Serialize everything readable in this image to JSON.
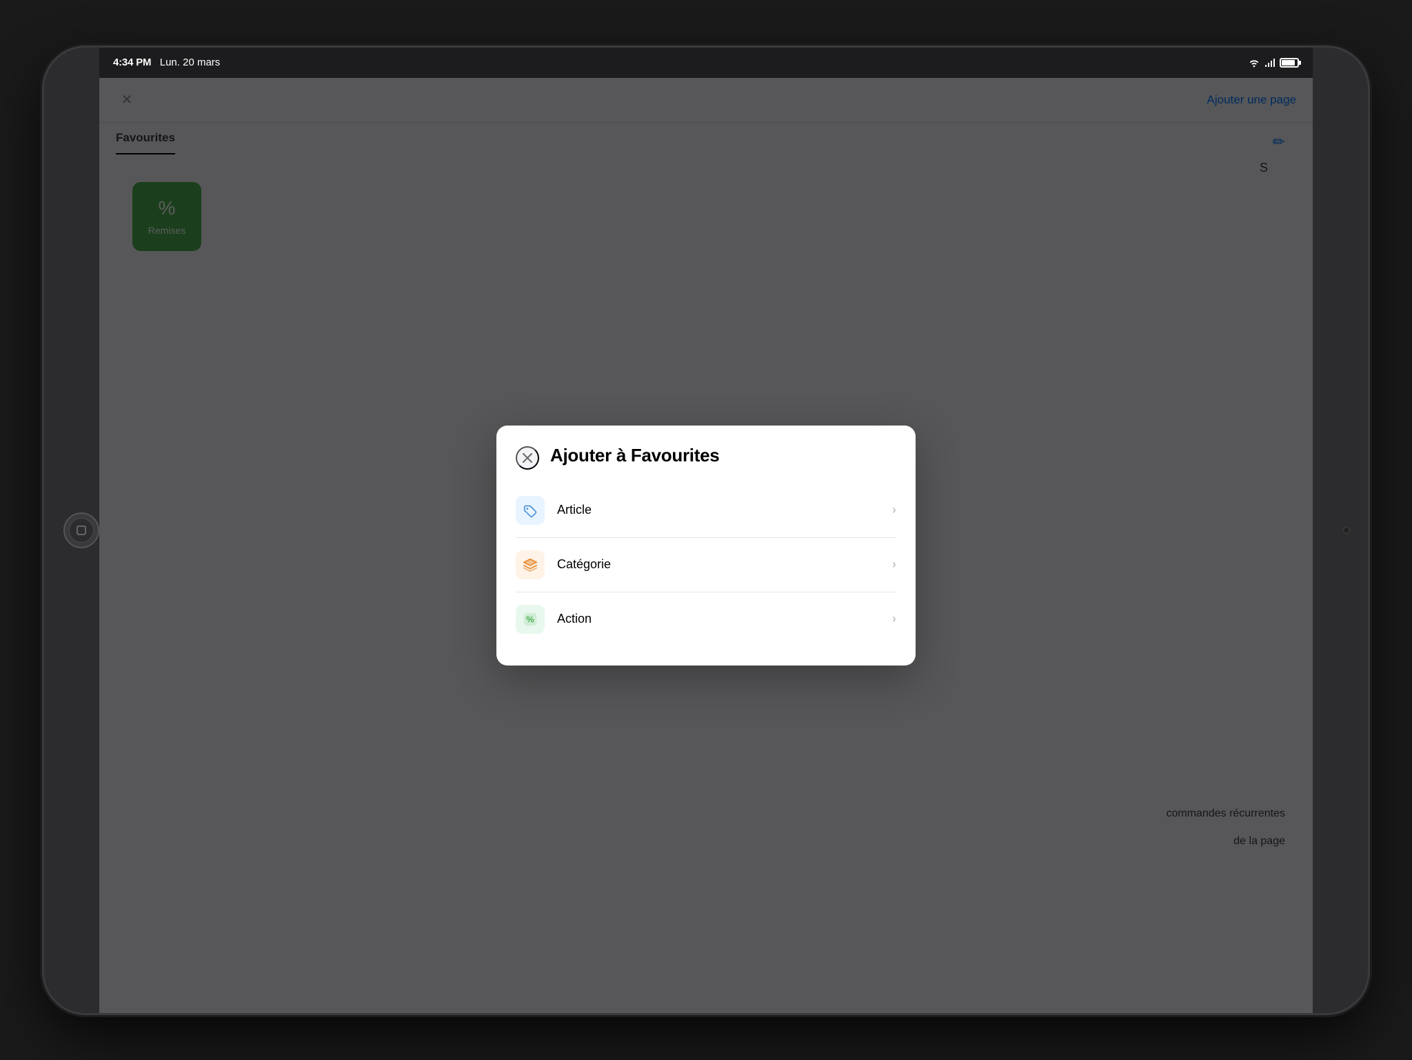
{
  "device": {
    "type": "iPad"
  },
  "statusBar": {
    "time": "4:34 PM",
    "date": "Lun. 20 mars"
  },
  "background": {
    "closeLabel": "×",
    "addPageLabel": "Ajouter une page",
    "tabLabel": "Favourites",
    "cardLabel": "Remises"
  },
  "modal": {
    "closeLabel": "×",
    "title": "Ajouter à Favourites",
    "items": [
      {
        "id": "article",
        "label": "Article",
        "iconType": "article",
        "iconBg": "#e8f4ff",
        "iconColor": "#4a90d9"
      },
      {
        "id": "categorie",
        "label": "Catégorie",
        "iconType": "categorie",
        "iconBg": "#fff3e8",
        "iconColor": "#e8903a"
      },
      {
        "id": "action",
        "label": "Action",
        "iconType": "action",
        "iconBg": "#e8f8ee",
        "iconColor": "#4caf50"
      }
    ],
    "chevron": "›"
  }
}
